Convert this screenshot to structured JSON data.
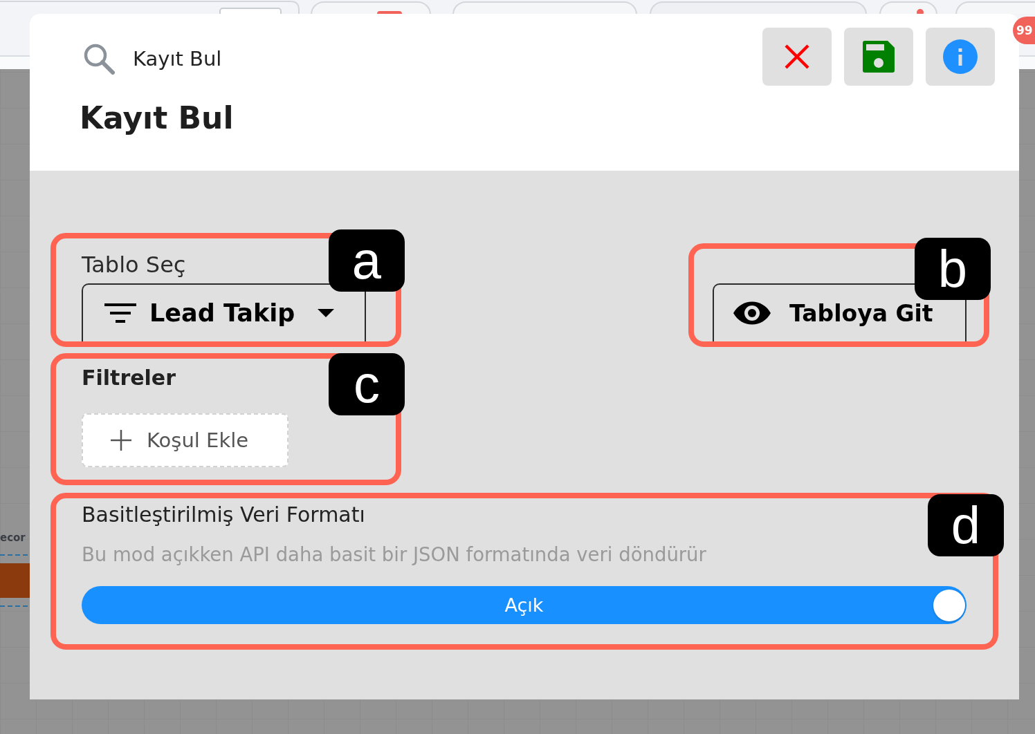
{
  "background": {
    "canvas_label": "ecor",
    "badge": "99"
  },
  "dialog": {
    "search_label": "Kayıt Bul",
    "title": "Kayıt Bul",
    "actions": [
      {
        "kind": "close"
      },
      {
        "kind": "save"
      },
      {
        "kind": "info"
      }
    ]
  },
  "table_select": {
    "label": "Tablo Seç",
    "value": "Lead Takip",
    "callout": "a"
  },
  "go_to_table": {
    "label": "Tabloya Git",
    "callout": "b"
  },
  "filters": {
    "title": "Filtreler",
    "add_button": "Koşul Ekle",
    "callout": "c"
  },
  "simplified_format": {
    "title": "Basitleştirilmiş Veri Formatı",
    "description": "Bu mod açıkken API daha basit bir JSON formatında veri döndürür",
    "switch": {
      "on": true,
      "label": "Açık"
    },
    "callout": "d"
  }
}
